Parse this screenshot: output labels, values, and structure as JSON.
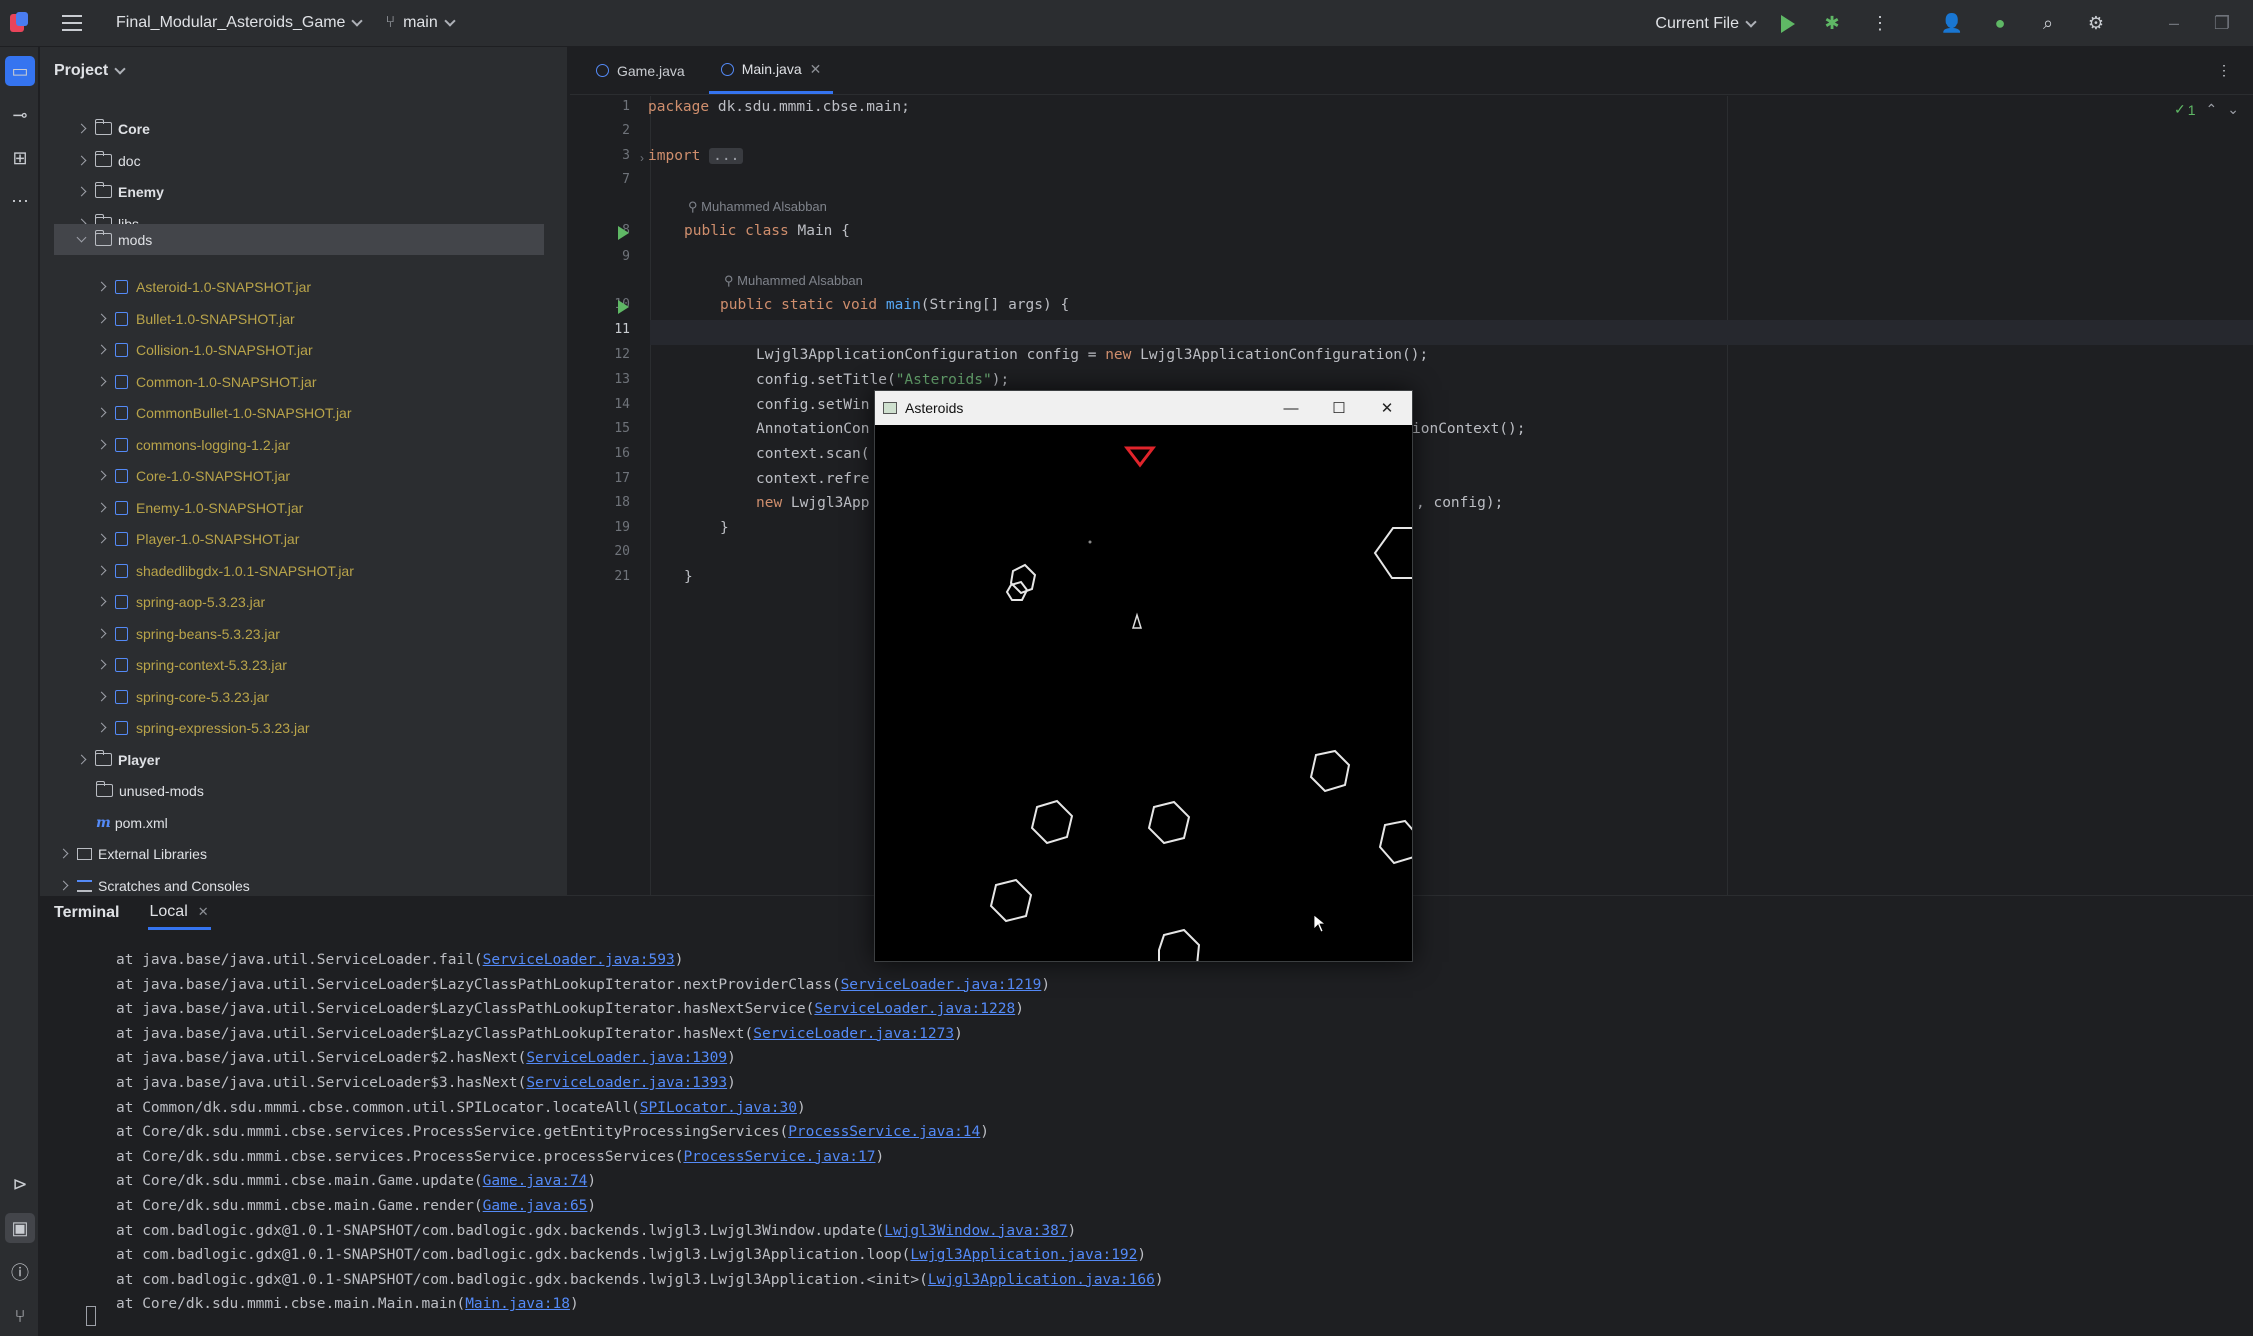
{
  "titlebar": {
    "project_name": "Final_Modular_Asteroids_Game",
    "branch": "main",
    "run_config": "Current File"
  },
  "sidebar": {
    "header": "Project",
    "items": [
      {
        "label": "Core"
      },
      {
        "label": "doc"
      },
      {
        "label": "Enemy"
      },
      {
        "label": "libs"
      },
      {
        "label": "mods"
      },
      {
        "label": "Asteroid-1.0-SNAPSHOT.jar"
      },
      {
        "label": "Bullet-1.0-SNAPSHOT.jar"
      },
      {
        "label": "Collision-1.0-SNAPSHOT.jar"
      },
      {
        "label": "Common-1.0-SNAPSHOT.jar"
      },
      {
        "label": "CommonBullet-1.0-SNAPSHOT.jar"
      },
      {
        "label": "commons-logging-1.2.jar"
      },
      {
        "label": "Core-1.0-SNAPSHOT.jar"
      },
      {
        "label": "Enemy-1.0-SNAPSHOT.jar"
      },
      {
        "label": "Player-1.0-SNAPSHOT.jar"
      },
      {
        "label": "shadedlibgdx-1.0.1-SNAPSHOT.jar"
      },
      {
        "label": "spring-aop-5.3.23.jar"
      },
      {
        "label": "spring-beans-5.3.23.jar"
      },
      {
        "label": "spring-context-5.3.23.jar"
      },
      {
        "label": "spring-core-5.3.23.jar"
      },
      {
        "label": "spring-expression-5.3.23.jar"
      },
      {
        "label": "Player"
      },
      {
        "label": "unused-mods"
      },
      {
        "label": "pom.xml"
      },
      {
        "label": "External Libraries"
      },
      {
        "label": "Scratches and Consoles"
      }
    ]
  },
  "editor": {
    "tabs": [
      {
        "label": "Game.java"
      },
      {
        "label": "Main.java"
      }
    ],
    "inspection_count": "1",
    "author": "Muhammed Alsabban",
    "line_numbers": [
      "1",
      "2",
      "3",
      "7",
      "8",
      "9",
      "10",
      "11",
      "12",
      "13",
      "14",
      "15",
      "16",
      "17",
      "18",
      "19",
      "20",
      "21"
    ],
    "lines": {
      "l1_kw": "package",
      "l1_rest": " dk.sdu.mmmi.cbse.main;",
      "l3_kw": "import",
      "l3_box": "...",
      "l8_kw": "public class",
      "l8_rest": " Main {",
      "l10_kw": "public static void",
      "l10_fn": "main",
      "l10_rest": "(String[] args) {",
      "l12_a": "Lwjgl3ApplicationConfiguration config = ",
      "l12_kw": "new",
      "l12_b": " Lwjgl3ApplicationConfiguration();",
      "l13_a": "config.setTitle(",
      "l13_str": "\"Asteroids\"",
      "l13_b": ");",
      "l14": "config.setWin",
      "l15_a": "AnnotationCon",
      "l15_b": "ionContext();",
      "l16": "context.scan(",
      "l17": "context.refre",
      "l18_kw": "new",
      "l18_a": " Lwjgl3App",
      "l18_b": ", config);",
      "l19": "}",
      "l21": "}"
    }
  },
  "terminal": {
    "title": "Terminal",
    "tab": "Local",
    "lines": [
      {
        "prefix": "at java.base/java.util.ServiceLoader.fail(",
        "link": "ServiceLoader.java:593",
        "suffix": ")"
      },
      {
        "prefix": "at java.base/java.util.ServiceLoader$LazyClassPathLookupIterator.nextProviderClass(",
        "link": "ServiceLoader.java:1219",
        "suffix": ")"
      },
      {
        "prefix": "at java.base/java.util.ServiceLoader$LazyClassPathLookupIterator.hasNextService(",
        "link": "ServiceLoader.java:1228",
        "suffix": ")"
      },
      {
        "prefix": "at java.base/java.util.ServiceLoader$LazyClassPathLookupIterator.hasNext(",
        "link": "ServiceLoader.java:1273",
        "suffix": ")"
      },
      {
        "prefix": "at java.base/java.util.ServiceLoader$2.hasNext(",
        "link": "ServiceLoader.java:1309",
        "suffix": ")"
      },
      {
        "prefix": "at java.base/java.util.ServiceLoader$3.hasNext(",
        "link": "ServiceLoader.java:1393",
        "suffix": ")"
      },
      {
        "prefix": "at Common/dk.sdu.mmmi.cbse.common.util.SPILocator.locateAll(",
        "link": "SPILocator.java:30",
        "suffix": ")"
      },
      {
        "prefix": "at Core/dk.sdu.mmmi.cbse.services.ProcessService.getEntityProcessingServices(",
        "link": "ProcessService.java:14",
        "suffix": ")"
      },
      {
        "prefix": "at Core/dk.sdu.mmmi.cbse.services.ProcessService.processServices(",
        "link": "ProcessService.java:17",
        "suffix": ")"
      },
      {
        "prefix": "at Core/dk.sdu.mmmi.cbse.main.Game.update(",
        "link": "Game.java:74",
        "suffix": ")"
      },
      {
        "prefix": "at Core/dk.sdu.mmmi.cbse.main.Game.render(",
        "link": "Game.java:65",
        "suffix": ")"
      },
      {
        "prefix": "at com.badlogic.gdx@1.0.1-SNAPSHOT/com.badlogic.gdx.backends.lwjgl3.Lwjgl3Window.update(",
        "link": "Lwjgl3Window.java:387",
        "suffix": ")"
      },
      {
        "prefix": "at com.badlogic.gdx@1.0.1-SNAPSHOT/com.badlogic.gdx.backends.lwjgl3.Lwjgl3Application.loop(",
        "link": "Lwjgl3Application.java:192",
        "suffix": ")"
      },
      {
        "prefix": "at com.badlogic.gdx@1.0.1-SNAPSHOT/com.badlogic.gdx.backends.lwjgl3.Lwjgl3Application.<init>(",
        "link": "Lwjgl3Application.java:166",
        "suffix": ")"
      },
      {
        "prefix": "at Core/dk.sdu.mmmi.cbse.main.Main.main(",
        "link": "Main.java:18",
        "suffix": ")"
      }
    ]
  },
  "game_window": {
    "title": "Asteroids"
  },
  "colors": {
    "accent": "#3574f0",
    "run_green": "#5fb865",
    "keyword": "#cf8e6d",
    "string": "#6aab73",
    "link": "#548af7",
    "enemy_red": "#e0242b"
  },
  "icons": {
    "run": "play-icon",
    "debug": "bug-icon",
    "search": "search-icon",
    "settings": "gear-icon"
  }
}
